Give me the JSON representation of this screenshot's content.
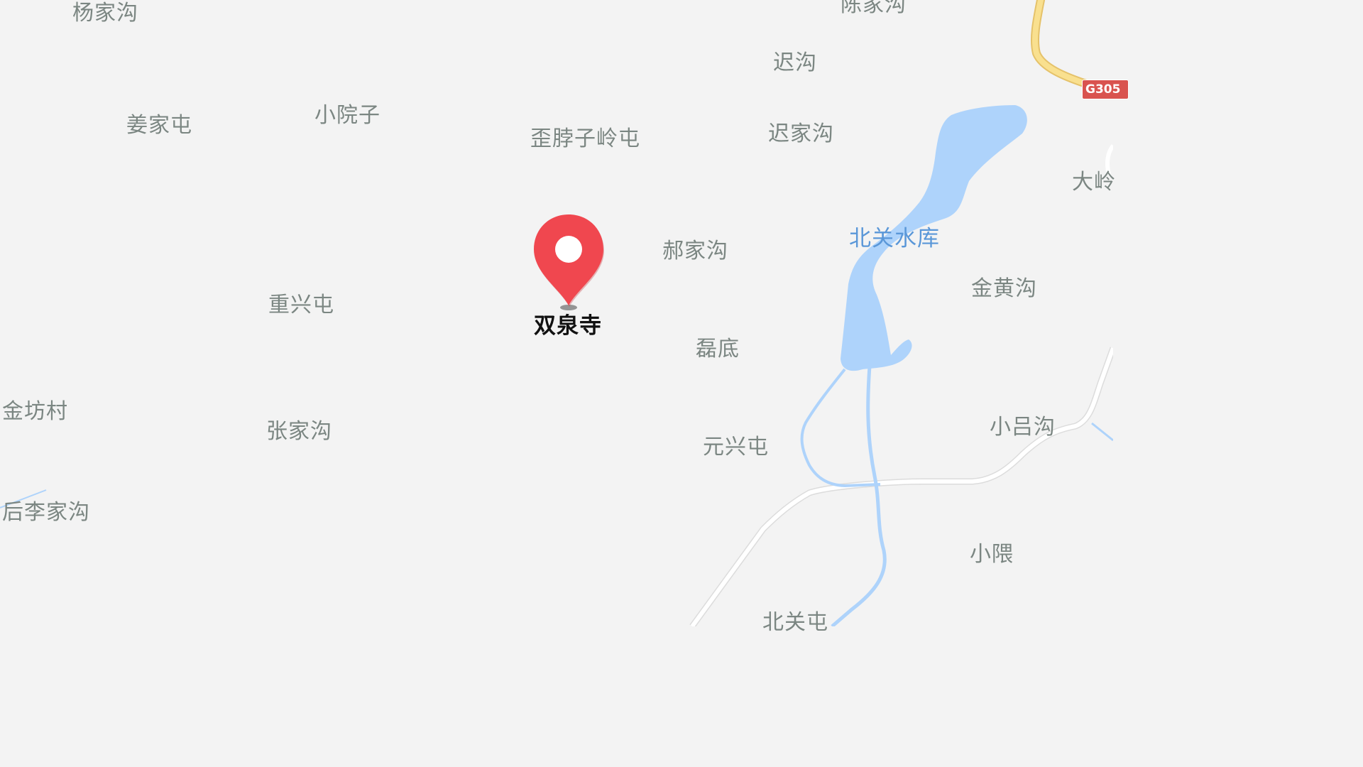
{
  "map": {
    "places": {
      "yangjiagou": "杨家沟",
      "chenjiagou": "陈家沟",
      "chigou": "迟沟",
      "jiangjiatun": "姜家屯",
      "xiaoyuanzi": "小院子",
      "waibozilingtun": "歪脖子岭屯",
      "chijiagou": "迟家沟",
      "daling": "大岭",
      "haojiagou": "郝家沟",
      "jinhuanggou": "金黄沟",
      "chongxingtun": "重兴屯",
      "leidi": "磊底",
      "jinfangcun": "金坊村",
      "zhangjiagou": "张家沟",
      "yuanxingtun": "元兴屯",
      "xiaolvgou": "小吕沟",
      "houlijiagou": "后李家沟",
      "xiaowei": "小隈",
      "beiguan": "北关屯"
    },
    "water": {
      "reservoir": "北关水库"
    },
    "road_shield": "G305",
    "selected_poi": {
      "name": "双泉寺",
      "pin_color": "#f0474f"
    },
    "colors": {
      "background": "#f3f3f3",
      "water": "#aed3fb",
      "highway": "#f9e08f",
      "road": "#ffffff",
      "shield": "#d9534f"
    }
  }
}
